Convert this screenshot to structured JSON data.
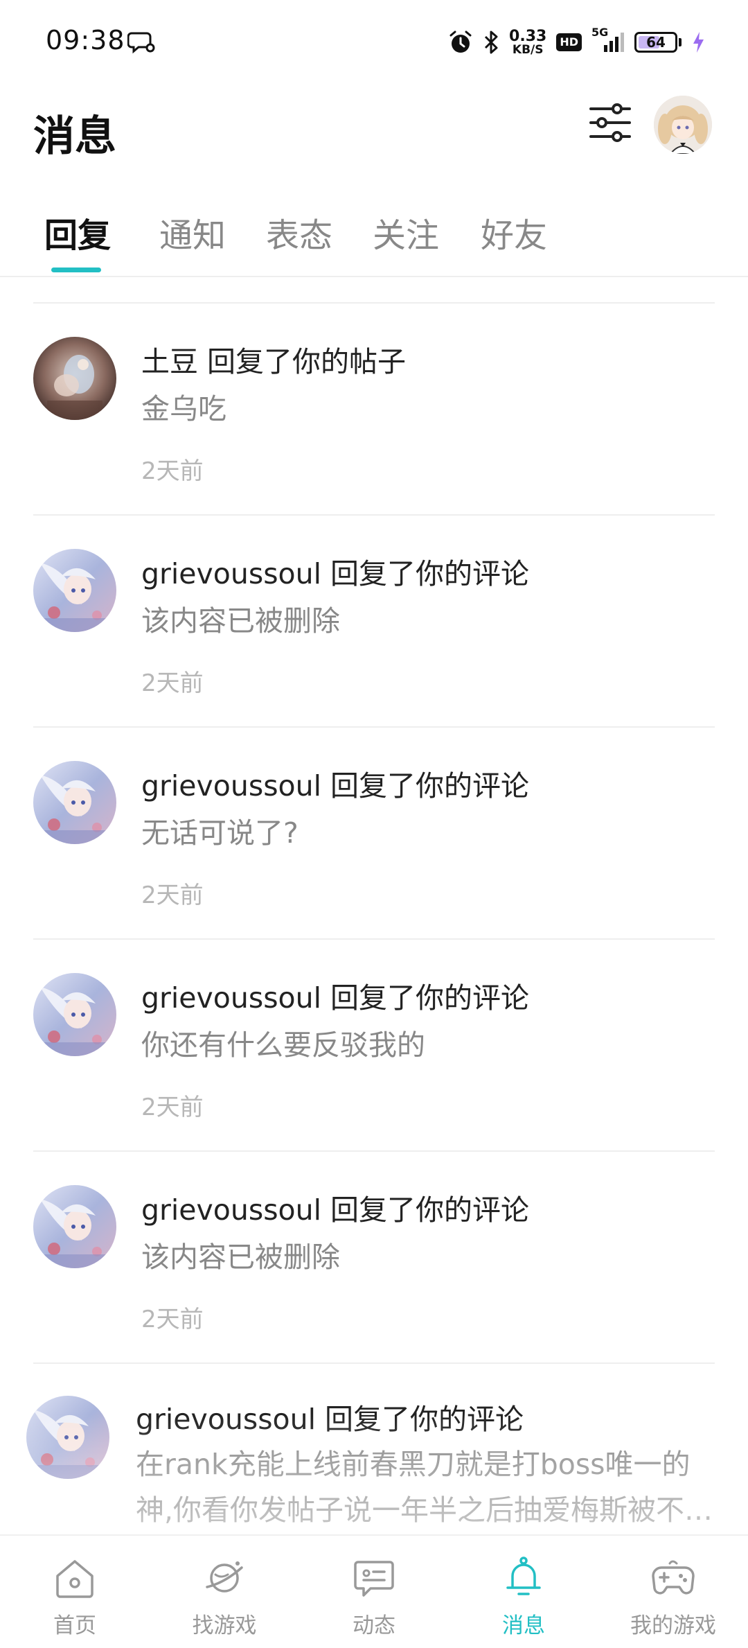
{
  "status_bar": {
    "time": "09:38",
    "net_speed_value": "0.33",
    "net_speed_unit": "KB/S",
    "hd_badge": "HD",
    "network_type": "5G",
    "battery_percent": "64",
    "battery_level": 0.64,
    "icons": [
      "chat-bubble-icon",
      "alarm-icon",
      "bluetooth-icon",
      "signal-icon",
      "battery-icon",
      "charging-icon"
    ]
  },
  "header": {
    "title": "消息",
    "filter_icon": "sliders-icon",
    "avatar_icon": "profile-avatar"
  },
  "tabs": [
    {
      "label": "回复",
      "active": true
    },
    {
      "label": "通知",
      "active": false
    },
    {
      "label": "表态",
      "active": false
    },
    {
      "label": "关注",
      "active": false
    },
    {
      "label": "好友",
      "active": false
    }
  ],
  "messages": [
    {
      "title": "土豆 回复了你的帖子",
      "body": "金乌吃",
      "time": "2天前"
    },
    {
      "title": "grievoussoul 回复了你的评论",
      "body": "该内容已被删除",
      "time": "2天前"
    },
    {
      "title": "grievoussoul 回复了你的评论",
      "body": "无话可说了?",
      "time": "2天前"
    },
    {
      "title": "grievoussoul 回复了你的评论",
      "body": "你还有什么要反驳我的",
      "time": "2天前"
    },
    {
      "title": "grievoussoul 回复了你的评论",
      "body": "该内容已被删除",
      "time": "2天前"
    },
    {
      "title": "grievoussoul 回复了你的评论",
      "body": "在rank充能上线前春黑刀就是打boss唯一的神,你看你发帖子说一年半之后抽爱梅斯被不…",
      "time": ""
    }
  ],
  "bottom_nav": [
    {
      "label": "首页",
      "icon": "home-icon",
      "active": false
    },
    {
      "label": "找游戏",
      "icon": "planet-icon",
      "active": false
    },
    {
      "label": "动态",
      "icon": "feed-card-icon",
      "active": false
    },
    {
      "label": "消息",
      "icon": "bell-icon",
      "active": true
    },
    {
      "label": "我的游戏",
      "icon": "gamepad-icon",
      "active": false
    }
  ],
  "colors": {
    "accent": "#22bfc4",
    "text_primary": "#222222",
    "text_secondary": "#888888",
    "text_tertiary": "#b7b7b7",
    "divider": "#eeeeee",
    "battery_fill": "#c9b7f3",
    "charging": "#9b6cf0"
  }
}
